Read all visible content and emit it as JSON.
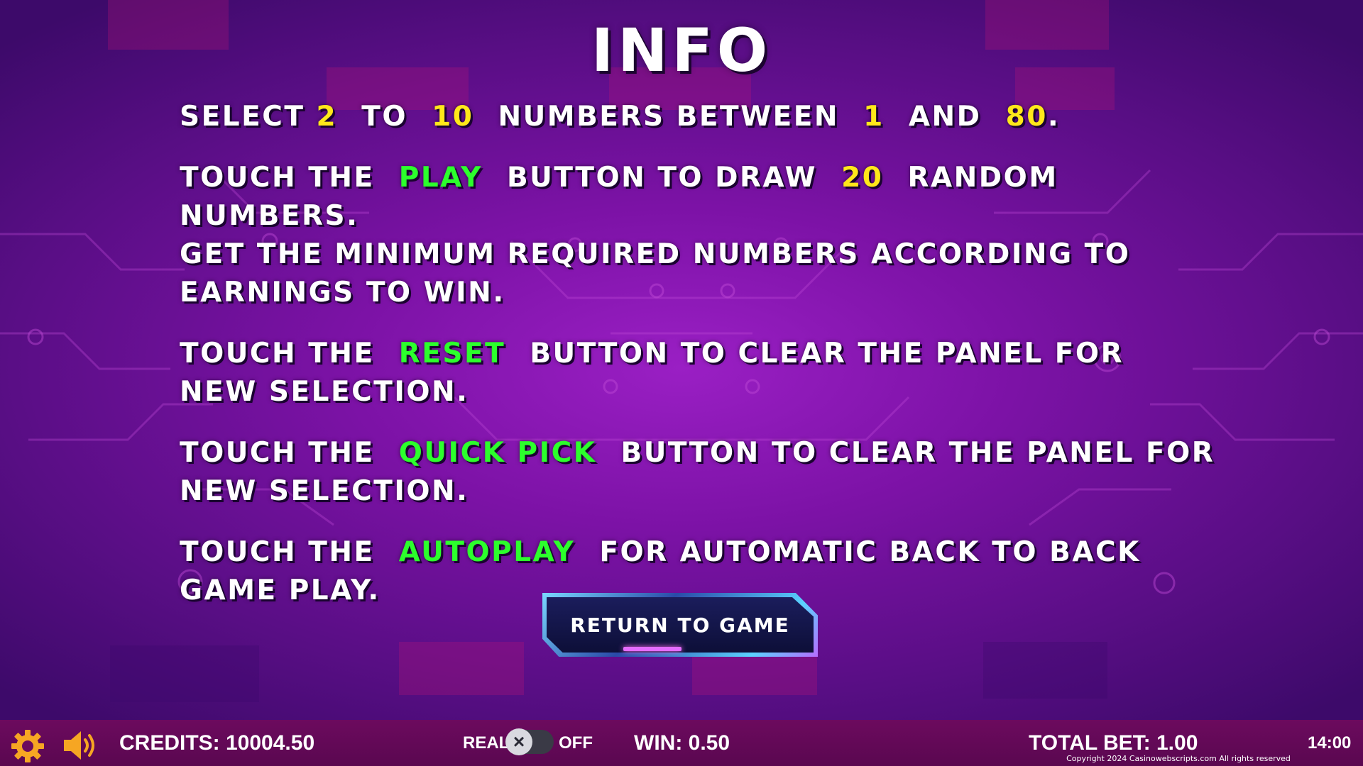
{
  "page": {
    "title": "INFO"
  },
  "rules": {
    "p1": {
      "a": "SELECT",
      "min": "2",
      "b": "TO",
      "max": "10",
      "c": "NUMBERS BETWEEN",
      "low": "1",
      "d": "AND",
      "high": "80",
      "e": "."
    },
    "p2": {
      "a": "TOUCH THE",
      "btn": "PLAY",
      "b": "BUTTON TO DRAW",
      "count": "20",
      "c": "RANDOM NUMBERS.",
      "d": "GET THE MINIMUM REQUIRED NUMBERS ACCORDING TO",
      "e": "EARNINGS TO WIN."
    },
    "p3": {
      "a": "TOUCH THE",
      "btn": "RESET",
      "b": "BUTTON TO CLEAR THE PANEL FOR",
      "c": "NEW SELECTION."
    },
    "p4": {
      "a": "TOUCH THE",
      "btn": "QUICK PICK",
      "b": "BUTTON TO CLEAR THE PANEL FOR",
      "c": "NEW SELECTION."
    },
    "p5": {
      "a": "TOUCH THE",
      "btn": "AUTOPLAY",
      "b": "FOR AUTOMATIC BACK TO BACK",
      "c": "GAME PLAY."
    }
  },
  "return_button": {
    "label": "RETURN TO GAME"
  },
  "bottom_bar": {
    "credits": "CREDITS: 10004.50",
    "real_label": "REAL",
    "off_label": "OFF",
    "win": "WIN: 0.50",
    "total_bet": "TOTAL BET: 1.00",
    "clock": "14:00",
    "copyright": "Copyright 2024 Casinowebscripts.com All rights reserved",
    "icons": {
      "settings": "gear-icon",
      "sound": "speaker-icon",
      "toggle_knob": "close-icon"
    }
  },
  "colors": {
    "highlight_number": "#ffe81a",
    "highlight_button": "#2cff2c",
    "icon_orange": "#f6a623",
    "bottom_bar": "#6c0a5e"
  }
}
